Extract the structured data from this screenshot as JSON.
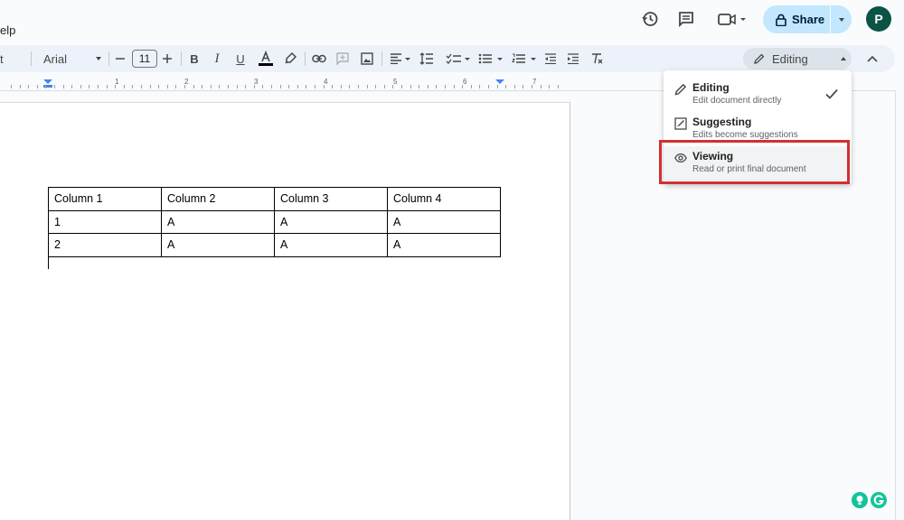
{
  "menu": {
    "help_fragment": "elp"
  },
  "header": {
    "share_label": "Share",
    "avatar_initial": "P",
    "icons": [
      "history-icon",
      "comment-icon",
      "meet-icon",
      "lock-icon"
    ]
  },
  "toolbar": {
    "style_fragment": "t",
    "font_name": "Arial",
    "font_size": "11",
    "mode_label": "Editing",
    "icons": [
      "decrease-size-icon",
      "increase-size-icon",
      "bold-icon",
      "italic-icon",
      "underline-icon",
      "text-color-icon",
      "highlight-icon",
      "link-icon",
      "add-comment-icon",
      "insert-image-icon",
      "align-icon",
      "line-spacing-icon",
      "checklist-icon",
      "bulleted-list-icon",
      "numbered-list-icon",
      "decrease-indent-icon",
      "increase-indent-icon",
      "clear-formatting-icon",
      "collapse-menu-icon"
    ]
  },
  "ruler": {
    "numbers": [
      "1",
      "2",
      "3",
      "4",
      "5",
      "6",
      "7"
    ]
  },
  "document": {
    "table": {
      "rows": [
        [
          "Column 1",
          "Column 2",
          "Column 3",
          "Column 4"
        ],
        [
          "1",
          "A",
          "A",
          "A"
        ],
        [
          "2",
          "A",
          "A",
          "A"
        ]
      ]
    }
  },
  "mode_menu": {
    "items": [
      {
        "title": "Editing",
        "desc": "Edit document directly",
        "icon": "pencil-icon",
        "checked": true
      },
      {
        "title": "Suggesting",
        "desc": "Edits become suggestions",
        "icon": "suggest-icon",
        "checked": false
      },
      {
        "title": "Viewing",
        "desc": "Read or print final document",
        "icon": "eye-icon",
        "checked": false
      }
    ],
    "highlight_color": "#d32f2f"
  },
  "colors": {
    "share_bg": "#c2e7ff",
    "avatar_bg": "#0b5344",
    "toolbar_bg": "#edf2fa"
  }
}
